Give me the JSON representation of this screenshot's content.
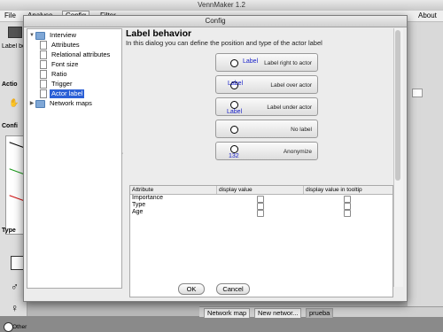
{
  "window": {
    "title": "VennMaker 1.2"
  },
  "menubar": {
    "items": [
      "File",
      "Analyse",
      "Config",
      "Filter",
      "About"
    ]
  },
  "left_panel": {
    "labels": [
      "Label behavio",
      "Actio",
      "Confi",
      "Type",
      "Other"
    ]
  },
  "bottom_tabs": [
    "Network map",
    "New networ...",
    "prueba"
  ],
  "dialog": {
    "title": "Config",
    "tree": {
      "items": [
        {
          "label": "Interview",
          "type": "folder",
          "expanded": true
        },
        {
          "label": "Attributes",
          "type": "doc"
        },
        {
          "label": "Relational attributes",
          "type": "doc"
        },
        {
          "label": "Font size",
          "type": "doc"
        },
        {
          "label": "Ratio",
          "type": "doc"
        },
        {
          "label": "Trigger",
          "type": "doc"
        },
        {
          "label": "Actor label",
          "type": "doc",
          "selected": true
        },
        {
          "label": "Network maps",
          "type": "folder",
          "expanded": false
        }
      ]
    },
    "heading": "Label behavior",
    "subtitle": "In this dialog you can define the position and type of the actor label",
    "options": [
      {
        "sample": "Label",
        "text": "Label right to actor"
      },
      {
        "sample": "Label",
        "text": "Label over actor"
      },
      {
        "sample": "Label",
        "text": "Label under actor"
      },
      {
        "sample": "",
        "text": "No label"
      },
      {
        "sample": "132",
        "text": "Anonymize"
      }
    ],
    "table": {
      "columns": [
        "Attribute",
        "display value",
        "display value in tooltip"
      ],
      "rows": [
        {
          "attribute": "Importance",
          "display": false,
          "tooltip": false
        },
        {
          "attribute": "Type",
          "display": false,
          "tooltip": false
        },
        {
          "attribute": "Age",
          "display": false,
          "tooltip": false
        }
      ]
    },
    "buttons": {
      "ok": "OK",
      "cancel": "Cancel"
    }
  }
}
